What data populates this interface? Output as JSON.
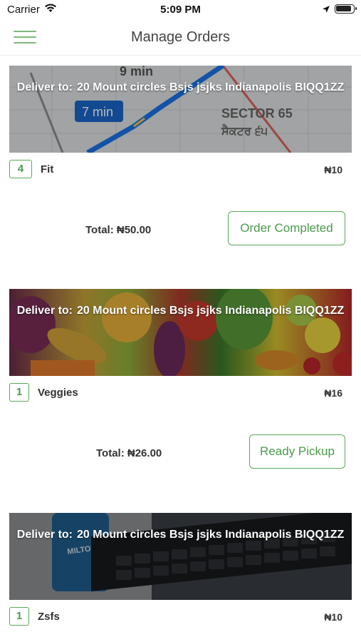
{
  "status_bar": {
    "carrier": "Carrier",
    "time": "5:09 PM"
  },
  "nav": {
    "title": "Manage Orders",
    "menu_icon": "hamburger-menu-icon"
  },
  "deliver_label": "Deliver to:",
  "orders": [
    {
      "address": "20 Mount circles Bsjs jsjks Indianapolis BIQQ1ZZ",
      "banner": "map",
      "map_labels": {
        "a": "9 min",
        "b": "7 min",
        "c": "SECTOR 65",
        "d": "ਸੈਕਟਰ ੬੫"
      },
      "qty": "4",
      "item": "Fit",
      "price": "₦10",
      "total": "Total: ₦50.00",
      "status": "Order Completed"
    },
    {
      "address": "20 Mount circles Bsjs jsjks Indianapolis BIQQ1ZZ",
      "banner": "vegetables",
      "qty": "1",
      "item": "Veggies",
      "price": "₦16",
      "total": "Total: ₦26.00",
      "status": "Ready Pickup"
    },
    {
      "address": "20 Mount circles Bsjs jsjks Indianapolis BIQQ1ZZ",
      "banner": "desk",
      "mug_text": "MILTON",
      "qty": "1",
      "item": "Zsfs",
      "price": "₦10"
    }
  ],
  "colors": {
    "accent": "#5aa85a",
    "menu_icon": "#7db87a"
  }
}
